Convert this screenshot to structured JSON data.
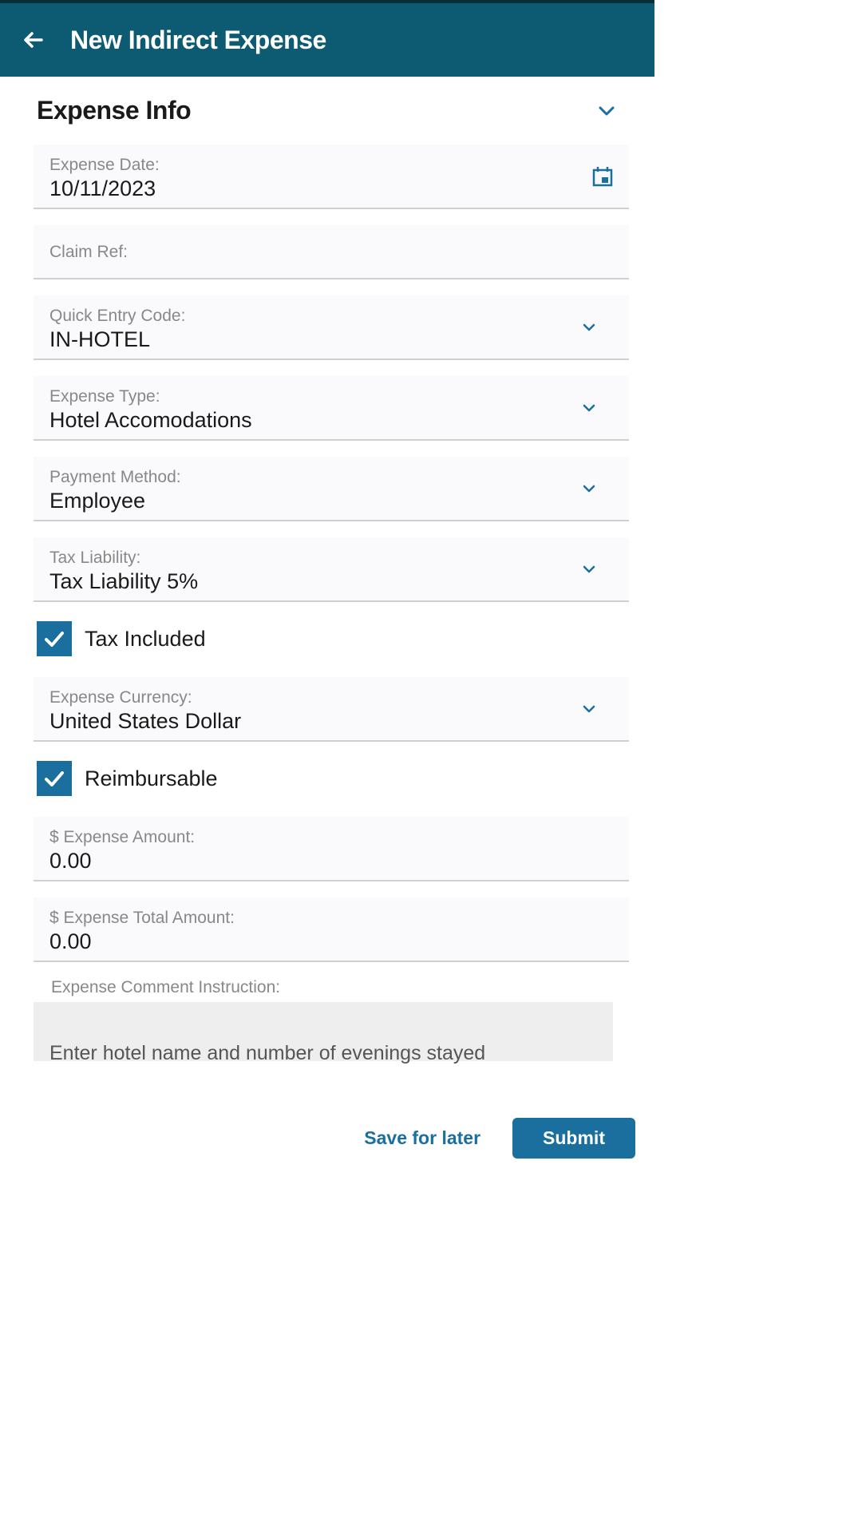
{
  "header": {
    "title": "New Indirect Expense"
  },
  "section": {
    "title": "Expense Info"
  },
  "fields": {
    "expense_date": {
      "label": "Expense Date:",
      "value": "10/11/2023"
    },
    "claim_ref": {
      "label": "Claim Ref:",
      "value": ""
    },
    "quick_entry": {
      "label": "Quick Entry Code:",
      "value": "IN-HOTEL"
    },
    "expense_type": {
      "label": "Expense Type:",
      "value": "Hotel Accomodations"
    },
    "payment_method": {
      "label": "Payment Method:",
      "value": "Employee"
    },
    "tax_liability": {
      "label": "Tax Liability:",
      "value": "Tax Liability 5%"
    },
    "tax_included": {
      "label": "Tax Included",
      "checked": true
    },
    "currency": {
      "label": "Expense Currency:",
      "value": "United States Dollar"
    },
    "reimbursable": {
      "label": "Reimbursable",
      "checked": true
    },
    "amount": {
      "label": "$ Expense Amount:",
      "value": "0.00"
    },
    "total_amount": {
      "label": "$ Expense Total Amount:",
      "value": "0.00"
    },
    "comment_instruction": {
      "label": "Expense Comment Instruction:",
      "placeholder": "Enter hotel name and number of evenings stayed"
    }
  },
  "actions": {
    "save": "Save for later",
    "submit": "Submit"
  }
}
